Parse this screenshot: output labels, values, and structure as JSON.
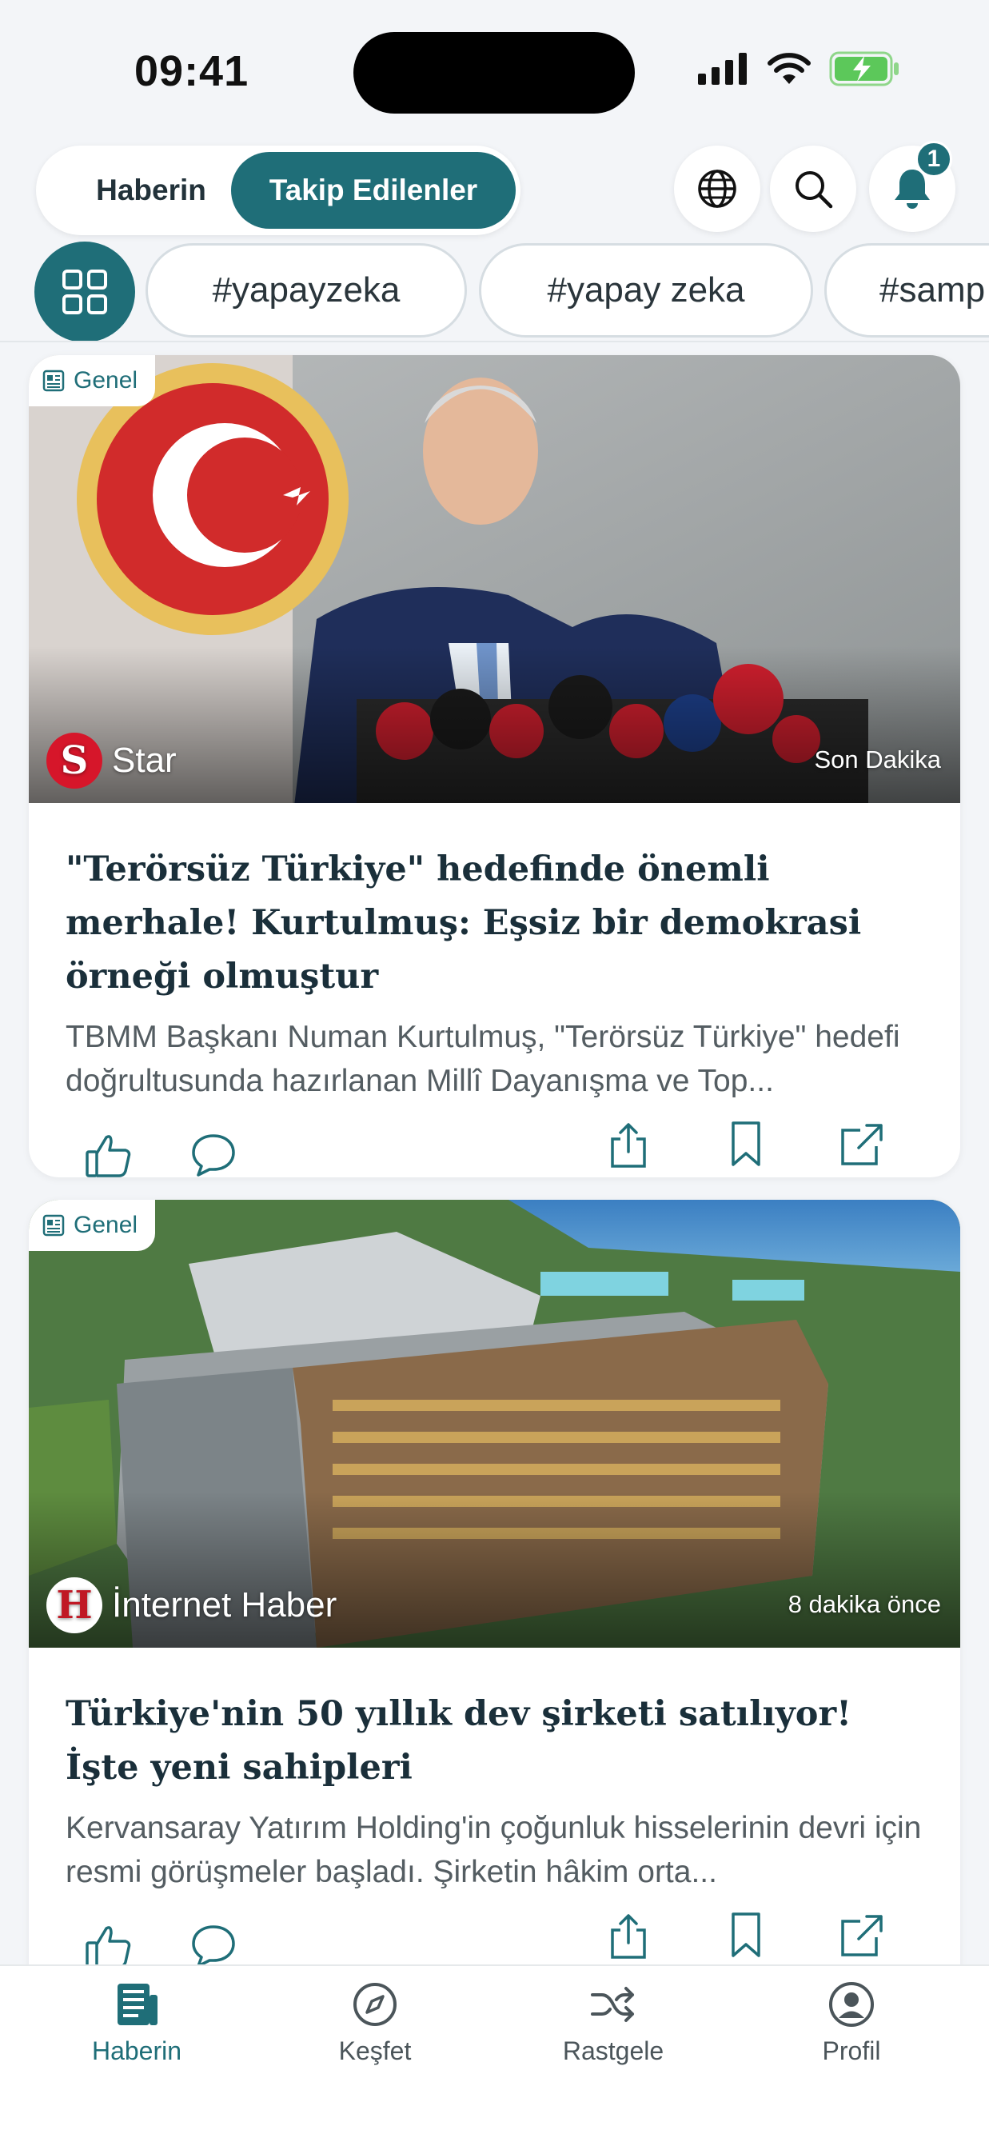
{
  "status": {
    "time": "09:41"
  },
  "header": {
    "tab_inactive": "Haberin",
    "tab_active": "Takip Edilenler",
    "notification_count": "1",
    "icons": [
      "globe-icon",
      "search-icon",
      "bell-icon"
    ]
  },
  "tags": [
    "#yapayzeka",
    "#yapay zeka",
    "#samp"
  ],
  "articles": [
    {
      "category": "Genel",
      "source": "Star",
      "time": "Son Dakika",
      "title": "\"Terörsüz Türkiye\" hedefinde önemli merhale! Kurtulmuş: Eşsiz bir demokrasi örneği olmuştur",
      "summary": "TBMM Başkanı Numan Kurtulmuş, \"Terörsüz Türkiye\" hedefi doğrultusunda hazırlanan Millî Dayanışma ve Top..."
    },
    {
      "category": "Genel",
      "source": "İnternet Haber",
      "time": "8 dakika önce",
      "title": "Türkiye'nin 50 yıllık dev şirketi satılıyor! İşte yeni sahipleri",
      "summary": "Kervansaray Yatırım Holding'in çoğunluk hisselerinin devri için resmi görüşmeler başladı. Şirketin hâkim orta..."
    }
  ],
  "nav": [
    {
      "label": "Haberin",
      "icon": "news-icon",
      "active": true
    },
    {
      "label": "Keşfet",
      "icon": "compass-icon",
      "active": false
    },
    {
      "label": "Rastgele",
      "icon": "shuffle-icon",
      "active": false
    },
    {
      "label": "Profil",
      "icon": "profile-icon",
      "active": false
    }
  ],
  "colors": {
    "accent": "#1f6e78",
    "background": "#f3f5f8"
  }
}
